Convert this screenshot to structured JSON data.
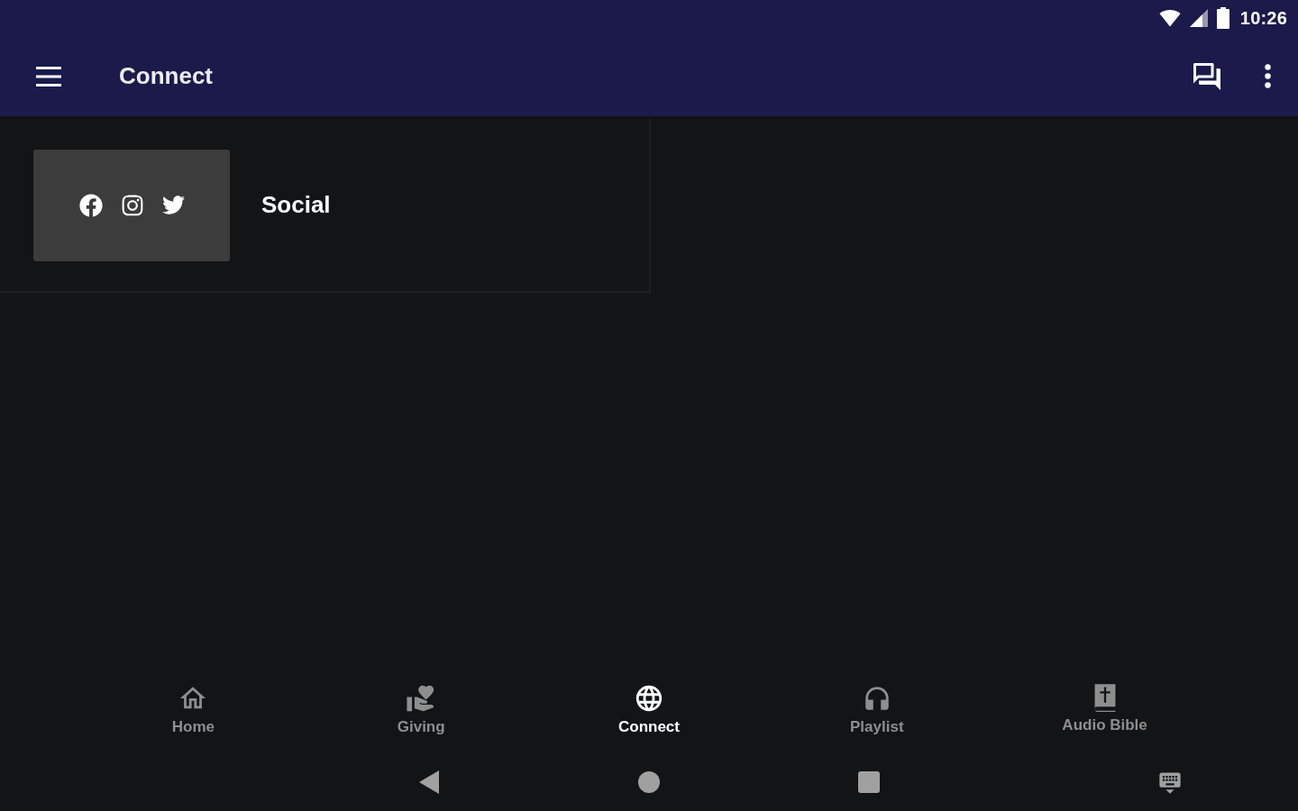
{
  "status_bar": {
    "time": "10:26"
  },
  "app_bar": {
    "title": "Connect"
  },
  "cards": [
    {
      "title": "Social"
    }
  ],
  "bottom_nav": [
    {
      "label": "Home",
      "selected": false
    },
    {
      "label": "Giving",
      "selected": false
    },
    {
      "label": "Connect",
      "selected": true
    },
    {
      "label": "Playlist",
      "selected": false
    },
    {
      "label": "Audio Bible",
      "selected": false
    }
  ]
}
